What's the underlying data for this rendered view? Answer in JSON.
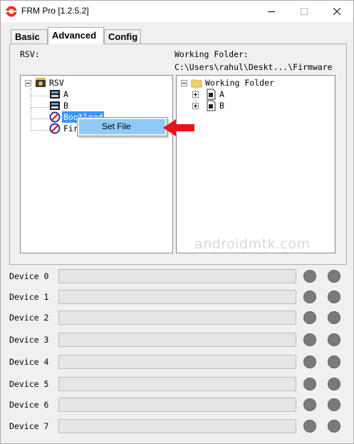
{
  "window": {
    "title": "FRM Pro [1.2.5.2]"
  },
  "tabs": [
    {
      "label": "Basic",
      "active": false
    },
    {
      "label": "Advanced",
      "active": true
    },
    {
      "label": "Config",
      "active": false
    }
  ],
  "advanced": {
    "rsv_label": "RSV:",
    "working_folder_label": "Working Folder:",
    "working_folder_path": "C:\\Users\\rahul\\Deskt...\\Firmware",
    "rsv_tree": {
      "root": "RSV",
      "children": [
        "A",
        "B",
        "Bootload",
        "Fir"
      ]
    },
    "folder_tree": {
      "root": "Working Folder",
      "children": [
        "A",
        "B"
      ]
    },
    "context_menu": {
      "items": [
        "Set File"
      ]
    }
  },
  "watermark": "androidmtk.com",
  "devices": [
    {
      "label": "Device 0"
    },
    {
      "label": "Device 1"
    },
    {
      "label": "Device 2"
    },
    {
      "label": "Device 3"
    },
    {
      "label": "Device 4"
    },
    {
      "label": "Device 5"
    },
    {
      "label": "Device 6"
    },
    {
      "label": "Device 7"
    }
  ],
  "colors": {
    "selection": "#3399ff",
    "menu_highlight": "#91c9f7",
    "arrow": "#e8141b",
    "led": "#7a7a7a"
  }
}
